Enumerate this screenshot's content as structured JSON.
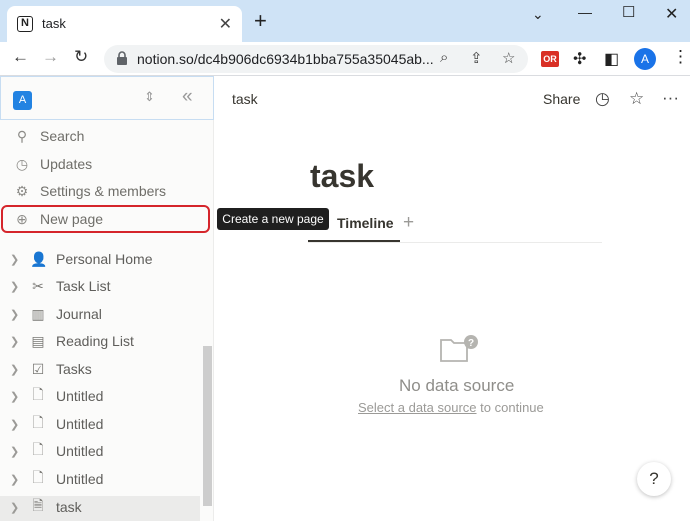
{
  "browser": {
    "tab_title": "task",
    "tab_favicon": "N",
    "url": "notion.so/dc4b906dc6934b1bba755a35045ab...",
    "extension_badge": "OR",
    "profile_initial": "A"
  },
  "sidebar": {
    "workspace_initial": "A",
    "nav": [
      {
        "label": "Search",
        "icon": "search-icon"
      },
      {
        "label": "Updates",
        "icon": "clock-icon"
      },
      {
        "label": "Settings & members",
        "icon": "gear-icon"
      },
      {
        "label": "New page",
        "icon": "plus-circle-icon"
      }
    ],
    "tooltip": "Create a new page",
    "pages": [
      {
        "label": "Personal Home",
        "icon": "person-icon"
      },
      {
        "label": "Task List",
        "icon": "scissors-icon"
      },
      {
        "label": "Journal",
        "icon": "book-icon"
      },
      {
        "label": "Reading List",
        "icon": "book-icon"
      },
      {
        "label": "Tasks",
        "icon": "checkbox-icon"
      },
      {
        "label": "Untitled",
        "icon": "page-icon"
      },
      {
        "label": "Untitled",
        "icon": "page-icon"
      },
      {
        "label": "Untitled",
        "icon": "page-icon"
      },
      {
        "label": "Untitled",
        "icon": "page-icon"
      },
      {
        "label": "task",
        "icon": "page-edit-icon"
      }
    ]
  },
  "main": {
    "breadcrumb": "task",
    "share_label": "Share",
    "title": "task",
    "view_tab": "Timeline",
    "empty_title": "No data source",
    "empty_link": "Select a data source",
    "empty_suffix": "to continue",
    "help_label": "?"
  }
}
